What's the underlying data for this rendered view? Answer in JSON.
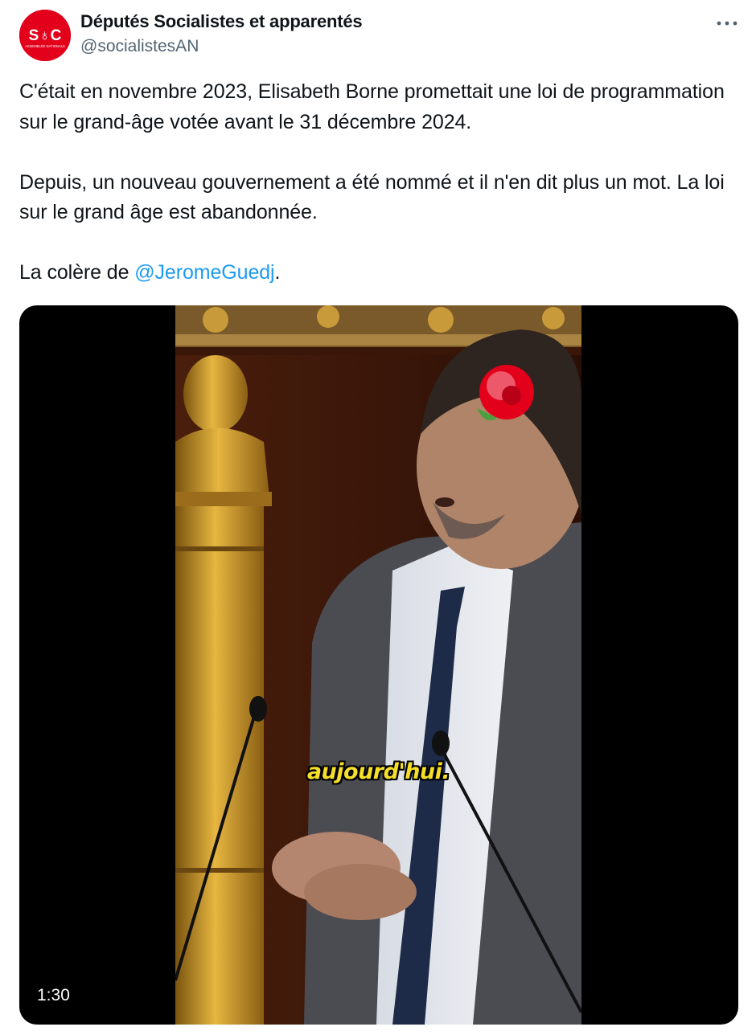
{
  "author": {
    "display_name": "Députés Socialistes et apparentés",
    "handle": "@socialistesAN",
    "avatar_logo_text": "S♁C",
    "avatar_logo_subtext": "ASSEMBLÉE NATIONALE"
  },
  "more_icon": "more-horizontal-icon",
  "tweet": {
    "paragraph1": "C'était en novembre 2023, Elisabeth Borne promettait une loi de programmation sur le grand-âge votée avant le 31 décembre 2024.",
    "paragraph2": "Depuis, un nouveau gouvernement a été nommé et il n'en dit plus un mot. La loi sur le grand âge est abandonnée.",
    "paragraph3_prefix": "La colère de ",
    "mention": "@JeromeGuedj",
    "paragraph3_suffix": "."
  },
  "video": {
    "caption": "aujourd'hui.",
    "duration": "1:30",
    "watermark_icon": "rose-logo-icon"
  },
  "colors": {
    "accent": "#1d9bf0",
    "brand_red": "#e3001b",
    "secondary_text": "#536471",
    "caption_yellow": "#f6df2a"
  }
}
